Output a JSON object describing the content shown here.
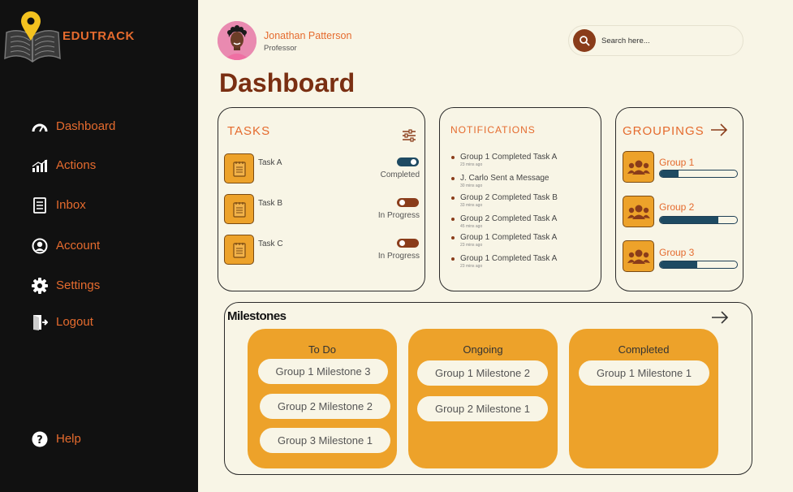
{
  "brand": {
    "name": "EDUTRACK"
  },
  "nav": [
    {
      "label": "Dashboard"
    },
    {
      "label": "Actions"
    },
    {
      "label": "Inbox"
    },
    {
      "label": "Account"
    },
    {
      "label": "Settings"
    },
    {
      "label": "Logout"
    }
  ],
  "help_label": "Help",
  "profile": {
    "name": "Jonathan Patterson",
    "role": "Professor"
  },
  "search": {
    "placeholder": "Search here..."
  },
  "page_title": "Dashboard",
  "tasks": {
    "title": "TASKS",
    "items": [
      {
        "name": "Task A",
        "status": "Completed",
        "on": true
      },
      {
        "name": "Task B",
        "status": "In Progress",
        "on": false
      },
      {
        "name": "Task C",
        "status": "In Progress",
        "on": false
      }
    ]
  },
  "notifications": {
    "title": "NOTIFICATIONS",
    "items": [
      {
        "text": "Group 1 Completed Task A",
        "time": "23 mins ago"
      },
      {
        "text": "J. Carlo Sent a Message",
        "time": "30 mins ago"
      },
      {
        "text": "Group 2 Completed Task B",
        "time": "33 mins ago"
      },
      {
        "text": "Group 2 Completed Task A",
        "time": "45 mins ago"
      },
      {
        "text": "Group 1 Completed Task A",
        "time": "23 mins ago"
      },
      {
        "text": "Group 1 Completed Task A",
        "time": "23 mins ago"
      }
    ]
  },
  "groupings": {
    "title": "GROUPINGS",
    "items": [
      {
        "name": "Group 1",
        "progress": 0.24
      },
      {
        "name": "Group 2",
        "progress": 0.76
      },
      {
        "name": "Group 3",
        "progress": 0.48
      }
    ]
  },
  "milestones": {
    "title": "Milestones",
    "columns": [
      {
        "title": "To Do",
        "items": [
          "Group 1 Milestone 3",
          "Group 2 Milestone 2",
          "Group 3 Milestone 1"
        ]
      },
      {
        "title": "Ongoing",
        "items": [
          "Group 1 Milestone 2",
          "Group 2 Milestone 1"
        ]
      },
      {
        "title": "Completed",
        "items": [
          "Group 1 Milestone 1"
        ]
      }
    ]
  },
  "colors": {
    "sidebar_bg": "#111111",
    "page_bg": "#f8f5e6",
    "accent_orange": "#e56b2e",
    "amber": "#eda22a",
    "title_brown": "#7a2f12",
    "navy": "#1e4a62"
  },
  "icons": {
    "logo": "book-location-pin-icon",
    "nav": [
      "speedometer-icon",
      "bar-chart-icon",
      "document-icon",
      "user-circle-icon",
      "gear-icon",
      "door-exit-icon"
    ],
    "help": "question-circle-icon",
    "search": "search-icon",
    "tasks_filter": "sliders-icon",
    "arrow": "arrow-right-icon",
    "task": "notepad-icon",
    "group": "users-icon"
  }
}
